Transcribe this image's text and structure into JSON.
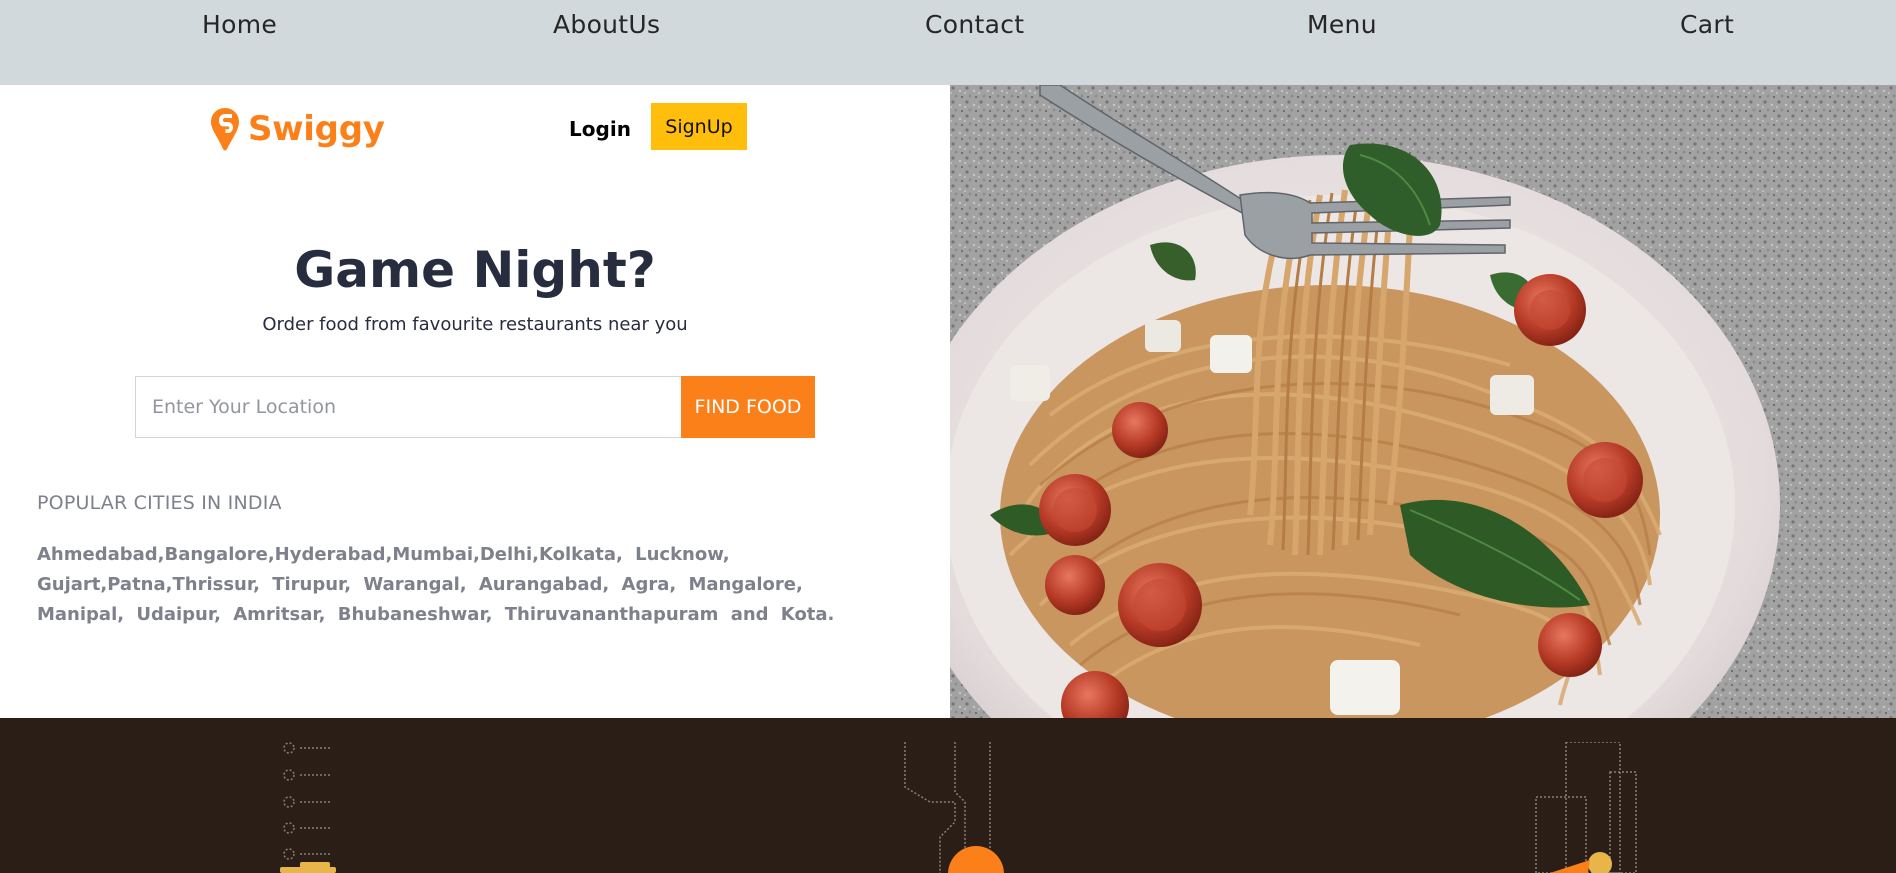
{
  "nav": {
    "items": [
      {
        "label": "Home"
      },
      {
        "label": "AboutUs"
      },
      {
        "label": "Contact"
      },
      {
        "label": "Menu"
      },
      {
        "label": "Cart"
      }
    ],
    "background": "#d1d9dd"
  },
  "header": {
    "brand": "Swiggy",
    "brand_color": "#fc8019",
    "login_label": "Login",
    "signup_label": "SignUp",
    "signup_color": "#ffbe0b"
  },
  "hero": {
    "title": "Game Night?",
    "subtitle": "Order food from favourite restaurants near you",
    "search": {
      "placeholder": "Enter Your Location",
      "value": "",
      "button_label": "FIND FOOD",
      "button_color": "#fc8019"
    },
    "image_icon": "pasta-photo"
  },
  "cities": {
    "title": "POPULAR CITIES IN INDIA",
    "text": "Ahmedabad,Bangalore,Hyderabad,Mumbai,Delhi,Kolkata, Lucknow, Gujart,Patna,Thrissur, Tirupur, Warangal, Aurangabad, Agra, Mangalore, Manipal, Udaipur, Amritsar, Bhubaneshwar, Thiruvananthapuram and Kota."
  },
  "footer_band": {
    "background": "#2b1e16",
    "icons": [
      "menu-list-icon",
      "delivery-route-icon",
      "building-icon"
    ]
  }
}
